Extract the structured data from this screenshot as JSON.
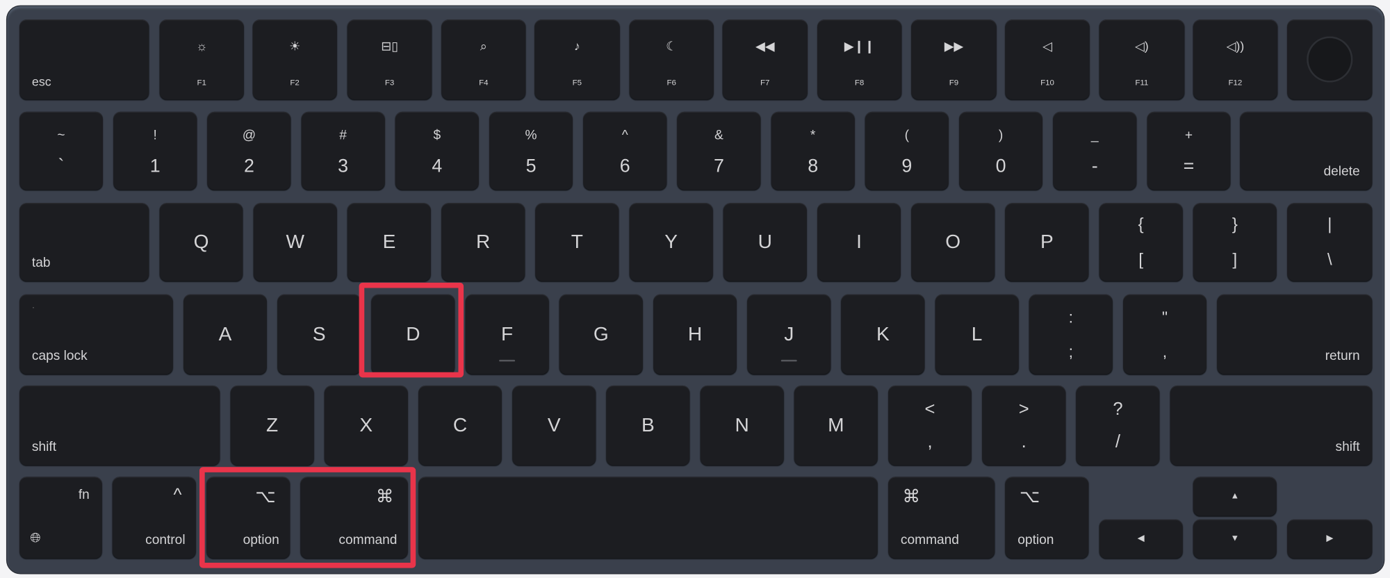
{
  "keyboard": {
    "colors": {
      "body": "#3a404c",
      "key": "#1c1d21",
      "legend": "#d4d4d6",
      "highlight": "#e9344a"
    },
    "function_row": [
      {
        "label": "esc"
      },
      {
        "label": "F1",
        "icon": "brightness-down-icon",
        "glyph": "☼"
      },
      {
        "label": "F2",
        "icon": "brightness-up-icon",
        "glyph": "☀"
      },
      {
        "label": "F3",
        "icon": "mission-control-icon",
        "glyph": "⊟▯"
      },
      {
        "label": "F4",
        "icon": "search-icon",
        "glyph": "⌕"
      },
      {
        "label": "F5",
        "icon": "microphone-icon",
        "glyph": "♪"
      },
      {
        "label": "F6",
        "icon": "moon-icon",
        "glyph": "☾"
      },
      {
        "label": "F7",
        "icon": "rewind-icon",
        "glyph": "◀◀"
      },
      {
        "label": "F8",
        "icon": "play-pause-icon",
        "glyph": "▶❙❙"
      },
      {
        "label": "F9",
        "icon": "fast-forward-icon",
        "glyph": "▶▶"
      },
      {
        "label": "F10",
        "icon": "mute-icon",
        "glyph": "◁"
      },
      {
        "label": "F11",
        "icon": "volume-down-icon",
        "glyph": "◁)"
      },
      {
        "label": "F12",
        "icon": "volume-up-icon",
        "glyph": "◁))"
      },
      {
        "label": "",
        "icon": "touch-id-icon"
      }
    ],
    "number_row": [
      {
        "top": "~",
        "main": "`"
      },
      {
        "top": "!",
        "main": "1"
      },
      {
        "top": "@",
        "main": "2"
      },
      {
        "top": "#",
        "main": "3"
      },
      {
        "top": "$",
        "main": "4"
      },
      {
        "top": "%",
        "main": "5"
      },
      {
        "top": "^",
        "main": "6"
      },
      {
        "top": "&",
        "main": "7"
      },
      {
        "top": "*",
        "main": "8"
      },
      {
        "top": "(",
        "main": "9"
      },
      {
        "top": ")",
        "main": "0"
      },
      {
        "top": "_",
        "main": "-"
      },
      {
        "top": "+",
        "main": "="
      },
      {
        "label": "delete"
      }
    ],
    "qwerty_row": [
      {
        "label": "tab"
      },
      {
        "main": "Q"
      },
      {
        "main": "W"
      },
      {
        "main": "E"
      },
      {
        "main": "R"
      },
      {
        "main": "T"
      },
      {
        "main": "Y"
      },
      {
        "main": "U"
      },
      {
        "main": "I"
      },
      {
        "main": "O"
      },
      {
        "main": "P"
      },
      {
        "top": "{",
        "main": "["
      },
      {
        "top": "}",
        "main": "]"
      },
      {
        "top": "|",
        "main": "\\"
      }
    ],
    "home_row": [
      {
        "label": "caps lock"
      },
      {
        "main": "A"
      },
      {
        "main": "S"
      },
      {
        "main": "D",
        "highlighted": true
      },
      {
        "main": "F"
      },
      {
        "main": "G"
      },
      {
        "main": "H"
      },
      {
        "main": "J"
      },
      {
        "main": "K"
      },
      {
        "main": "L"
      },
      {
        "top": ":",
        "main": ";"
      },
      {
        "top": "\"",
        "main": ","
      },
      {
        "label": "return"
      }
    ],
    "shift_row": [
      {
        "label": "shift"
      },
      {
        "main": "Z"
      },
      {
        "main": "X"
      },
      {
        "main": "C"
      },
      {
        "main": "V"
      },
      {
        "main": "B"
      },
      {
        "main": "N"
      },
      {
        "main": "M"
      },
      {
        "top": "<",
        "main": ","
      },
      {
        "top": ">",
        "main": "."
      },
      {
        "top": "?",
        "main": "/"
      },
      {
        "label": "shift"
      }
    ],
    "bottom_row": [
      {
        "label": "fn",
        "icon": "globe-icon",
        "glyph": "🌐︎"
      },
      {
        "label": "control",
        "symbol": "^"
      },
      {
        "label": "option",
        "symbol": "⌥",
        "highlighted": true
      },
      {
        "label": "command",
        "symbol": "⌘",
        "highlighted": true
      },
      {
        "label": ""
      },
      {
        "label": "command",
        "symbol": "⌘"
      },
      {
        "label": "option",
        "symbol": "⌥"
      },
      {
        "glyph": "◀",
        "icon": "arrow-left-icon"
      },
      {
        "glyph": "▲",
        "icon": "arrow-up-icon"
      },
      {
        "glyph": "▼",
        "icon": "arrow-down-icon"
      },
      {
        "glyph": "▶",
        "icon": "arrow-right-icon"
      }
    ]
  }
}
